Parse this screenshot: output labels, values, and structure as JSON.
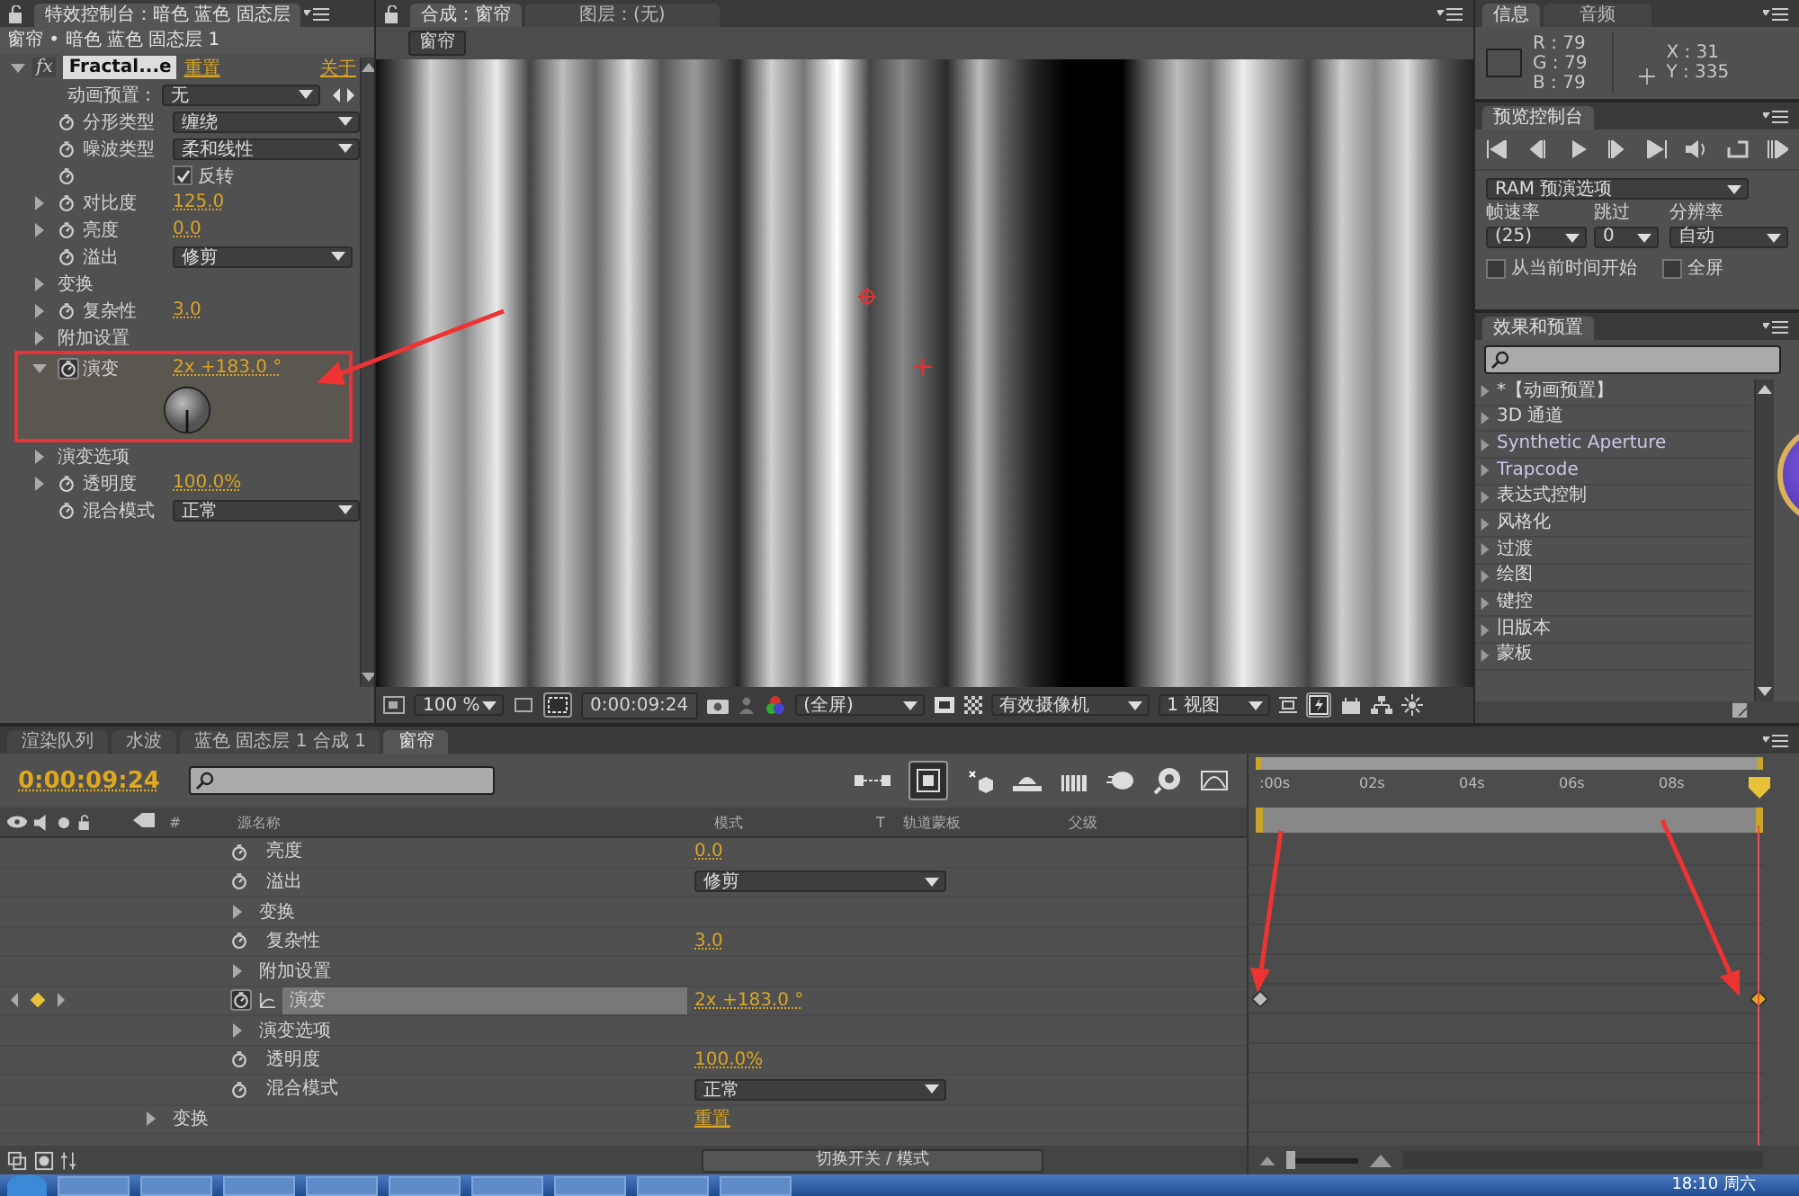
{
  "effect_controls": {
    "tab": "特效控制台：暗色 蓝色 固态层",
    "breadcrumb": "窗帘 • 暗色 蓝色 固态层 1",
    "effect": {
      "icon_label": "fx",
      "name": "Fractal...e",
      "expanded": true,
      "reset": "重置",
      "about": "关于"
    },
    "properties": [
      {
        "kind": "preset",
        "label": "动画预置 :",
        "value": "无"
      },
      {
        "kind": "dropdown",
        "label": "分形类型",
        "value": "缠绕"
      },
      {
        "kind": "dropdown",
        "label": "噪波类型",
        "value": "柔和线性"
      },
      {
        "kind": "checkbox",
        "label": "反转",
        "checked": true
      },
      {
        "kind": "value",
        "label": "对比度",
        "value": "125.0",
        "expanded": false
      },
      {
        "kind": "value",
        "label": "亮度",
        "value": "0.0",
        "expanded": false
      },
      {
        "kind": "dropdown",
        "label": "溢出",
        "value": "修剪"
      },
      {
        "kind": "group",
        "label": "变换",
        "expanded": false
      },
      {
        "kind": "value",
        "label": "复杂性",
        "value": "3.0",
        "expanded": false
      },
      {
        "kind": "group",
        "label": "附加设置",
        "expanded": false
      },
      {
        "kind": "dial",
        "label": "演变",
        "value": "2x +183.0 °",
        "expanded": true,
        "highlighted": true
      },
      {
        "kind": "group",
        "label": "演变选项",
        "expanded": false
      },
      {
        "kind": "value",
        "label": "透明度",
        "value": "100.0%",
        "expanded": false
      },
      {
        "kind": "dropdown",
        "label": "混合模式",
        "value": "正常"
      }
    ]
  },
  "viewer": {
    "tabs": [
      {
        "label": "合成：窗帘",
        "selected": true
      },
      {
        "label": "图层：(无)",
        "selected": false
      }
    ],
    "comp_button": "窗帘",
    "toolbar": {
      "zoom": "100 %",
      "timecode": "0:00:09:24",
      "resolution": "(全屏)",
      "camera": "有效摄像机",
      "views": "1 视图"
    }
  },
  "info": {
    "tabs": [
      {
        "label": "信息",
        "selected": true
      },
      {
        "label": "音频",
        "selected": false
      }
    ],
    "r": "R : 79",
    "g": "G : 79",
    "b": "B : 79",
    "x": "X : 31",
    "y": "Y : 335"
  },
  "preview": {
    "tab": "预览控制台",
    "ram": "RAM 预演选项",
    "frame_rate_label": "帧速率",
    "skip_label": "跳过",
    "resolution_label": "分辨率",
    "frame_rate": "(25)",
    "skip": "0",
    "resolution": "自动",
    "options": [
      {
        "label": "从当前时间开始",
        "checked": false
      },
      {
        "label": "全屏",
        "checked": false
      }
    ]
  },
  "effects_presets": {
    "tab": "效果和预置",
    "items": [
      "*【动画预置】",
      "3D 通道",
      "Synthetic Aperture",
      "Trapcode",
      "表达式控制",
      "风格化",
      "过渡",
      "绘图",
      "键控",
      "旧版本",
      "蒙板"
    ]
  },
  "timeline": {
    "tabs": [
      {
        "label": "渲染队列",
        "selected": false
      },
      {
        "label": "水波",
        "selected": false
      },
      {
        "label": "蓝色 固态层 1 合成 1",
        "selected": false
      },
      {
        "label": "窗帘",
        "selected": true
      }
    ],
    "timecode": "0:00:09:24",
    "columns": {
      "number": "#",
      "source_name": "源名称",
      "mode": "模式",
      "t": "T",
      "track_matte": "轨道蒙板",
      "parent": "父级"
    },
    "ruler": [
      ":00s",
      "02s",
      "04s",
      "06s",
      "08s"
    ],
    "effect_properties": [
      {
        "kind": "value",
        "label": "亮度",
        "value": "0.0"
      },
      {
        "kind": "dropdown",
        "label": "溢出",
        "value": "修剪"
      },
      {
        "kind": "group",
        "label": "变换",
        "expanded": false
      },
      {
        "kind": "value",
        "label": "复杂性",
        "value": "3.0"
      },
      {
        "kind": "group",
        "label": "附加设置",
        "expanded": false
      },
      {
        "kind": "animated",
        "label": "演变",
        "value": "2x +183.0 °",
        "selected": true,
        "at_keyframe": true,
        "keyframes": {
          "start": true,
          "current": true
        }
      },
      {
        "kind": "group",
        "label": "演变选项",
        "expanded": false
      },
      {
        "kind": "value",
        "label": "透明度",
        "value": "100.0%"
      },
      {
        "kind": "dropdown",
        "label": "混合模式",
        "value": "正常"
      }
    ],
    "layer_groups": [
      {
        "label": "变换",
        "expanded": false,
        "value": "重置"
      }
    ],
    "switch_button": "切换开关 / 模式",
    "zoom": {
      "level": 0.05
    }
  },
  "taskbar": {
    "clock": "18:10 周六"
  }
}
